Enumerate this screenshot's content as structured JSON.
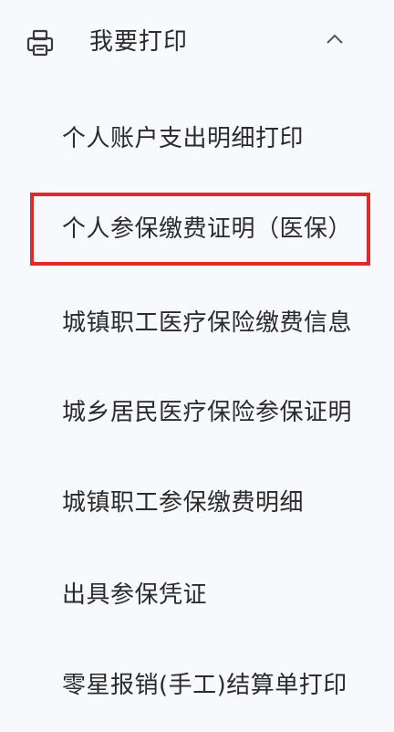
{
  "menu": {
    "header": {
      "label": "我要打印",
      "icon": "printer-icon",
      "expanded": true,
      "toggle_icon": "chevron-up-icon"
    },
    "items": [
      {
        "label": "个人账户支出明细打印"
      },
      {
        "label": "个人参保缴费证明（医保）",
        "highlighted": true
      },
      {
        "label": "城镇职工医疗保险缴费信息"
      },
      {
        "label": "城乡居民医疗保险参保证明"
      },
      {
        "label": "城镇职工参保缴费明细"
      },
      {
        "label": "出具参保凭证"
      },
      {
        "label": "零星报销(手工)结算单打印"
      }
    ]
  },
  "colors": {
    "background": "#f8f9fc",
    "text": "#2b2b2b",
    "highlight_border": "#e02a2a"
  }
}
